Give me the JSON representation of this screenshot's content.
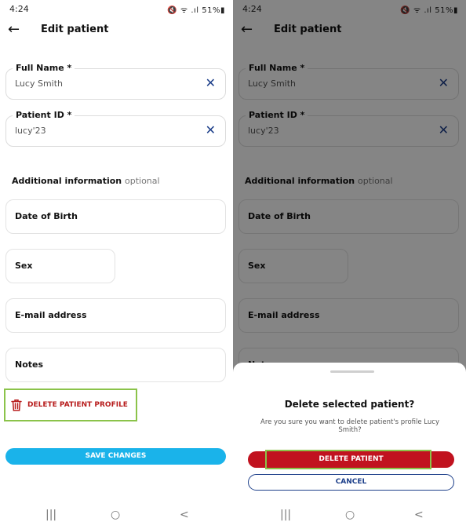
{
  "status": {
    "time": "4:24",
    "icons": "🔇 ᯤ .ıl 51%▮"
  },
  "header": {
    "back_icon": "←",
    "title": "Edit patient"
  },
  "form": {
    "full_name": {
      "label": "Full Name *",
      "value": "Lucy Smith"
    },
    "patient_id": {
      "label": "Patient ID *",
      "value": "lucy'23"
    },
    "clear_icon": "✕",
    "additional_title": "Additional information",
    "additional_optional": "optional",
    "date_of_birth": "Date of Birth",
    "sex": "Sex",
    "email": "E-mail address",
    "notes": "Notes",
    "notes_partial": "Notes"
  },
  "actions": {
    "delete_profile_label": "DELETE PATIENT PROFILE",
    "save_label": "SAVE CHANGES"
  },
  "dialog": {
    "title": "Delete selected patient?",
    "message": "Are you sure you want to delete patient's profile Lucy Smith?",
    "delete_label": "DELETE PATIENT",
    "cancel_label": "CANCEL"
  },
  "navbar": {
    "recents": "|||",
    "home": "○",
    "back": "<"
  },
  "colors": {
    "accent_blue": "#1ab3ea",
    "danger_red": "#c1121f",
    "highlight_green": "#8bc34a",
    "icon_navy": "#1d3f8a"
  }
}
